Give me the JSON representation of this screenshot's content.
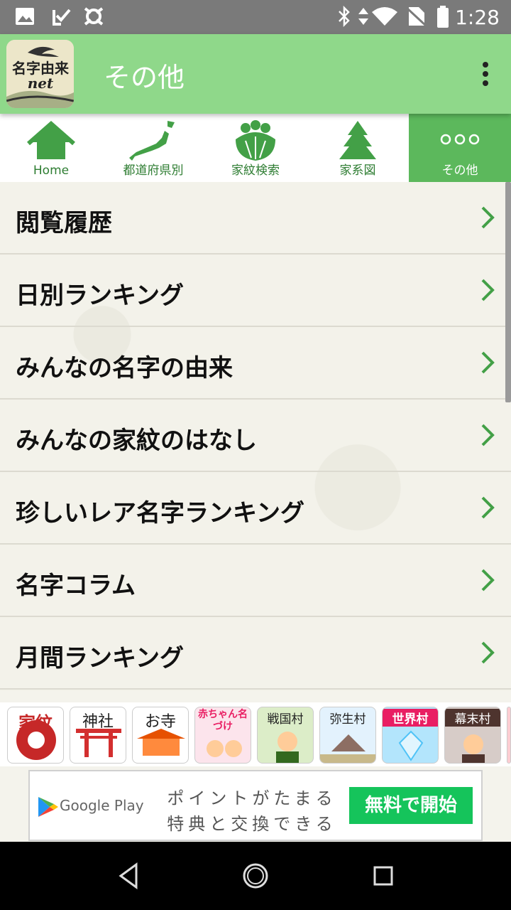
{
  "status_bar": {
    "time": "1:28"
  },
  "app_bar": {
    "title": "その他",
    "logo_text_line1": "名字由来",
    "logo_text_line2": "net"
  },
  "tabs": [
    {
      "label": "Home",
      "icon": "house-icon"
    },
    {
      "label": "都道府県別",
      "icon": "japan-map-icon"
    },
    {
      "label": "家紋検索",
      "icon": "family-crest-icon"
    },
    {
      "label": "家系図",
      "icon": "tree-icon"
    },
    {
      "label": "その他",
      "icon": "more-dots-icon",
      "active": true
    }
  ],
  "menu_items": [
    "閲覧履歴",
    "日別ランキング",
    "みんなの名字の由来",
    "みんなの家紋のはなし",
    "珍しいレア名字ランキング",
    "名字コラム",
    "月間ランキング"
  ],
  "banners": [
    {
      "text": "家紋",
      "color": "#c62828"
    },
    {
      "text": "神社",
      "color": "#d32f2f"
    },
    {
      "text": "お寺",
      "color": "#e65100"
    },
    {
      "text": "赤ちゃん名づけ",
      "color": "#e91e63"
    },
    {
      "text": "戦国村",
      "color": "#33691e"
    },
    {
      "text": "弥生村",
      "color": "#5d4037"
    },
    {
      "text": "世界村",
      "color": "#0277bd"
    },
    {
      "text": "幕末村",
      "color": "#4e342e"
    }
  ],
  "ad": {
    "brand": "Google Play",
    "line1": "ポイントがたまる",
    "line2": "特典と交換できる",
    "cta": "無料で開始"
  },
  "colors": {
    "app_bar": "#8fd88a",
    "tab_active": "#5cb85c",
    "tab_icon": "#43a047",
    "chevron": "#43a047"
  }
}
